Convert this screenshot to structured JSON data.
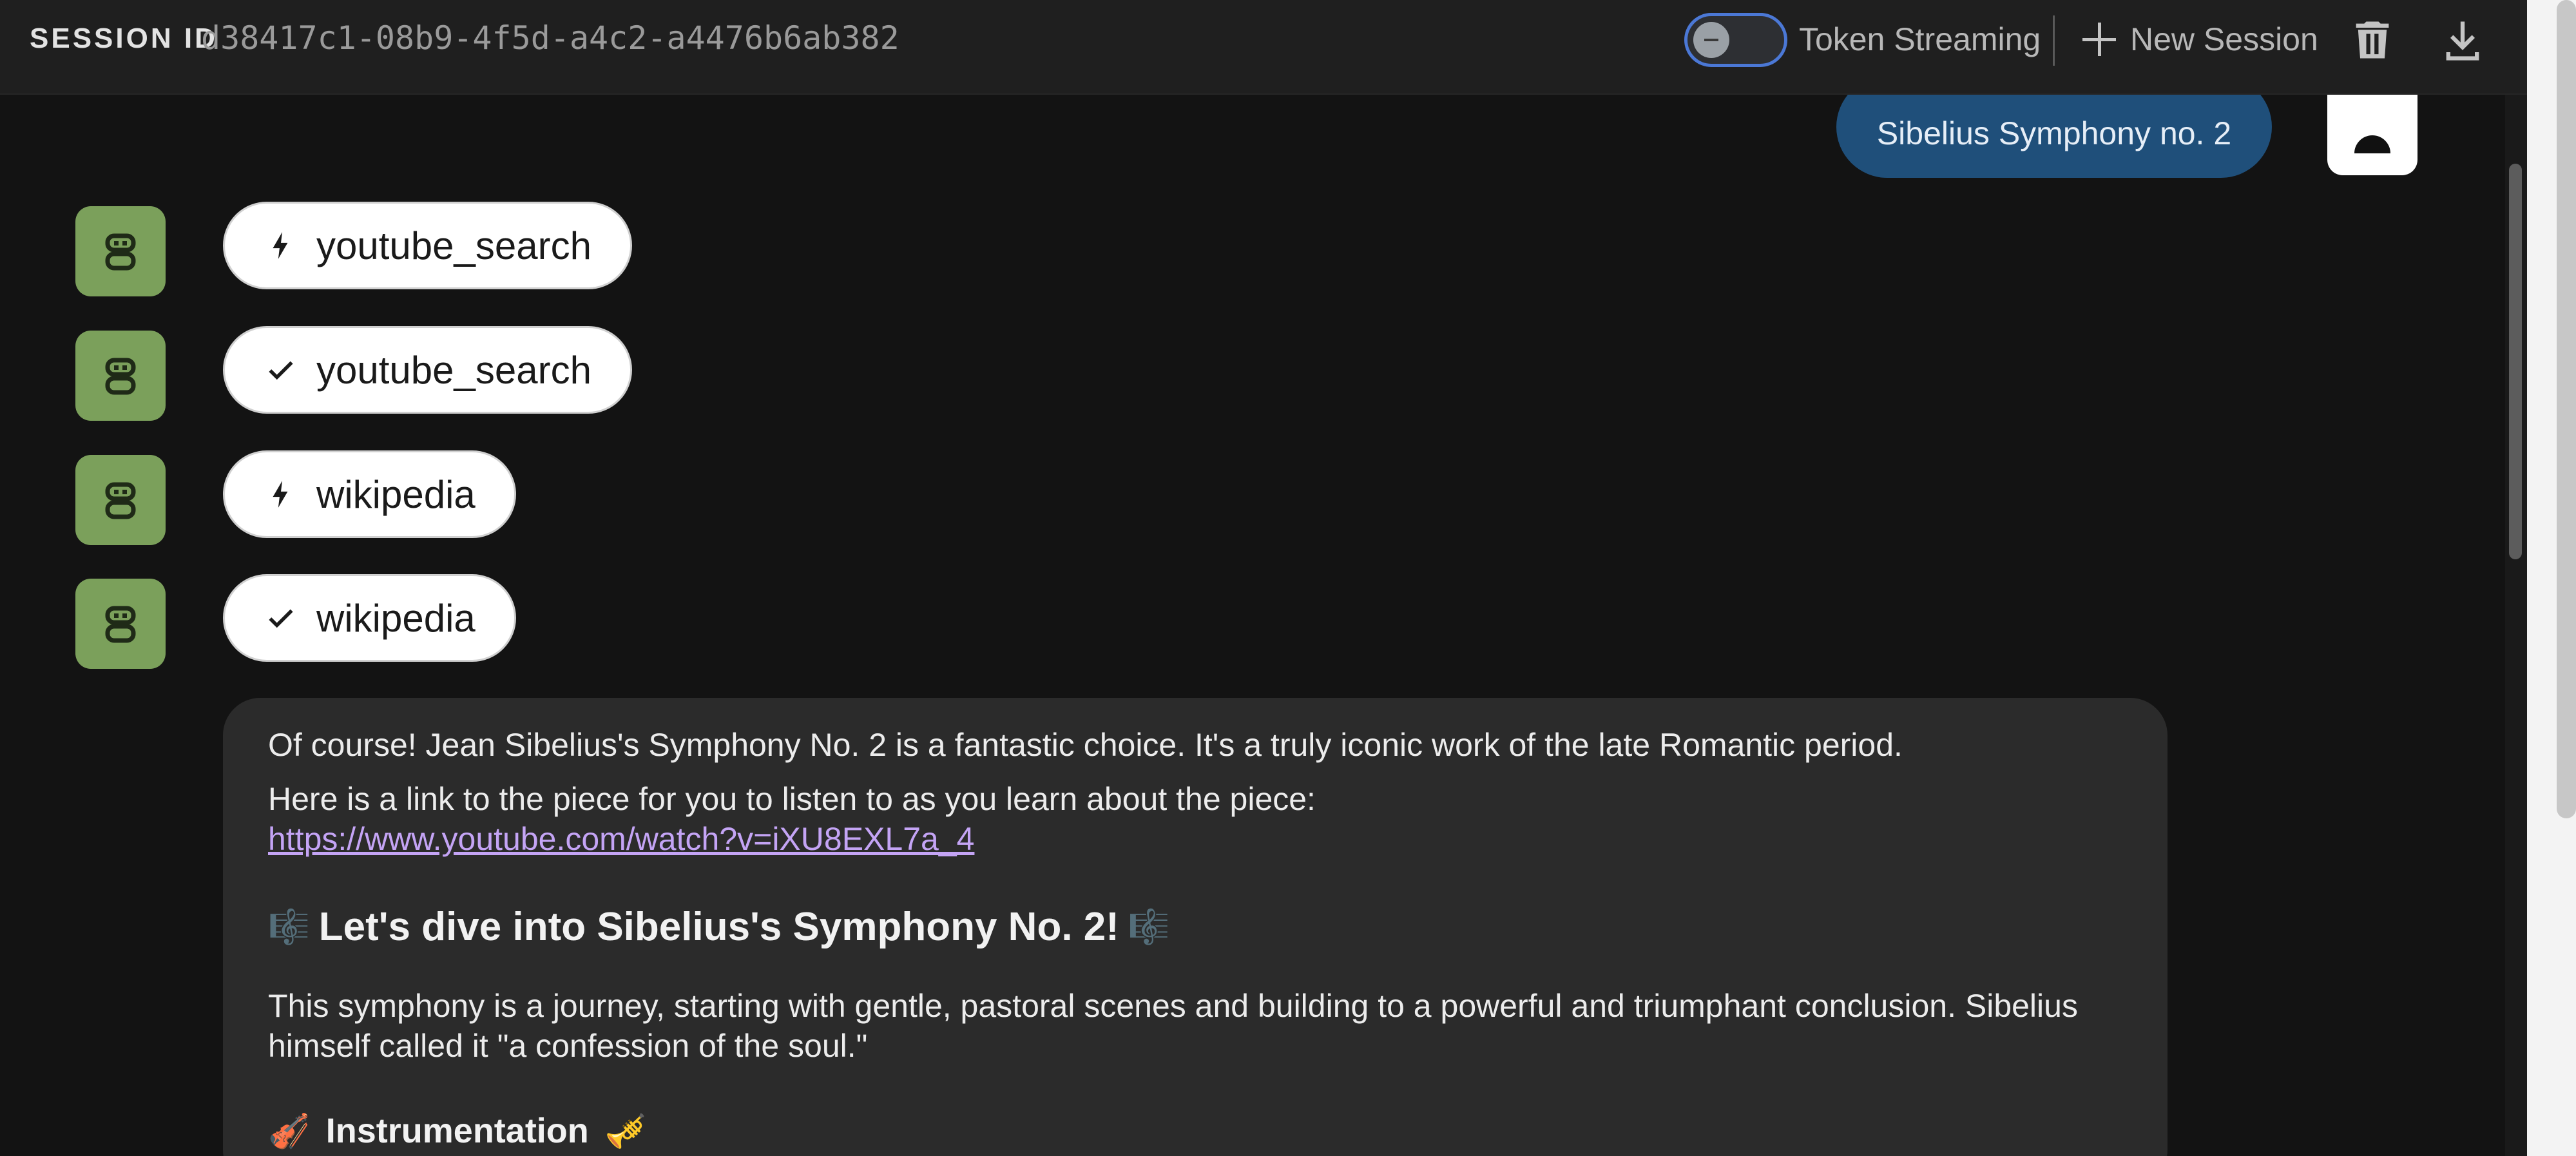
{
  "header": {
    "session_label": "SESSION ID",
    "session_id": "d38417c1-08b9-4f5d-a4c2-a4476b6ab382",
    "token_streaming_label": "Token Streaming",
    "token_streaming_on": false,
    "new_session_label": "New Session"
  },
  "user_message": {
    "text": "Sibelius Symphony no. 2"
  },
  "tool_calls": [
    {
      "status": "running",
      "icon": "bolt-icon",
      "label": "youtube_search"
    },
    {
      "status": "done",
      "icon": "check-icon",
      "label": "youtube_search"
    },
    {
      "status": "running",
      "icon": "bolt-icon",
      "label": "wikipedia"
    },
    {
      "status": "done",
      "icon": "check-icon",
      "label": "wikipedia"
    }
  ],
  "response": {
    "intro": "Of course! Jean Sibelius's Symphony No. 2 is a fantastic choice. It's a truly iconic work of the late Romantic period.",
    "link_intro": "Here is a link to the piece for you to listen to as you learn about the piece:",
    "link": "https://www.youtube.com/watch?v=iXU8EXL7a_4",
    "heading": "Let's dive into Sibelius's Symphony No. 2!",
    "heading_emoji": "🎼",
    "body": "This symphony is a journey, starting with gentle, pastoral scenes and building to a powerful and triumphant conclusion. Sibelius himself called it \"a confession of the soul.\"",
    "subheading": "Instrumentation",
    "subheading_emoji_left": "🎻",
    "subheading_emoji_right": "🎺"
  },
  "colors": {
    "background": "#131313",
    "topbar": "#1f1f1f",
    "bot_avatar": "#7ba05b",
    "user_bubble": "#1f4f7a",
    "link": "#c4a4f5",
    "toggle_border": "#4b78d6"
  }
}
